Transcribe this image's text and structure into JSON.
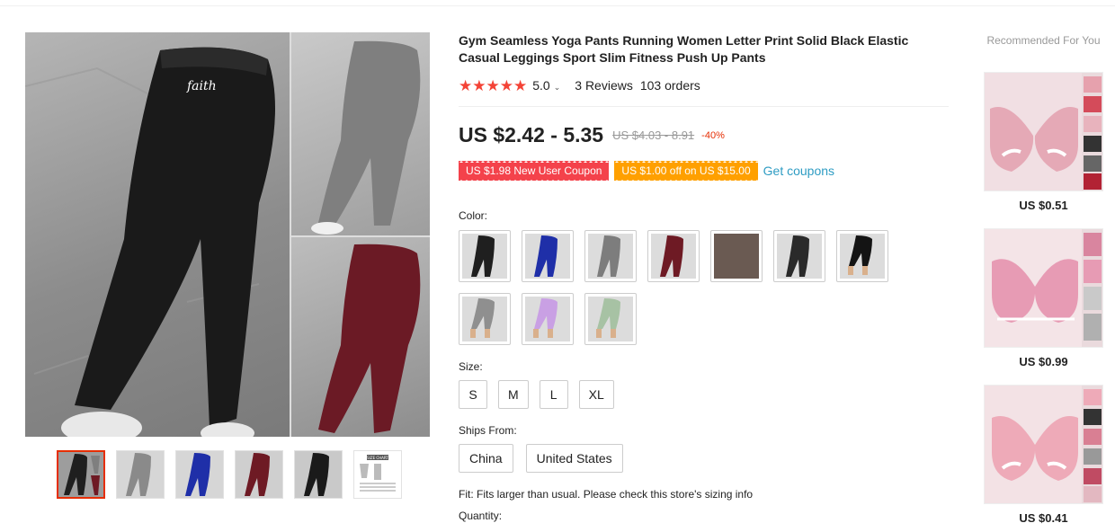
{
  "product": {
    "title": "Gym Seamless Yoga Pants Running Women Letter Print Solid Black Elastic Casual Leggings Sport Slim Fitness Push Up Pants",
    "rating": "5.0",
    "reviews": "3 Reviews",
    "orders": "103 orders",
    "price": "US $2.42 - 5.35",
    "original_price": "US $4.03 - 8.91",
    "discount": "-40%",
    "gallery_text": "faith"
  },
  "coupons": {
    "new_user": "US $1.98 New User Coupon",
    "store": "US $1.00 off on US $15.00",
    "get_link": "Get coupons"
  },
  "options": {
    "color_label": "Color:",
    "colors": [
      {
        "name": "black",
        "hex": "#1f1f1f"
      },
      {
        "name": "royal blue",
        "hex": "#1f2fa8"
      },
      {
        "name": "gray",
        "hex": "#7d7d7d"
      },
      {
        "name": "wine red",
        "hex": "#6e1a24"
      },
      {
        "name": "printed",
        "hex": "#6a5a52"
      },
      {
        "name": "black mesh",
        "hex": "#2a2a2a"
      },
      {
        "name": "black capri",
        "hex": "#141414"
      },
      {
        "name": "gray capri",
        "hex": "#8f8f8f"
      },
      {
        "name": "lilac capri",
        "hex": "#c9a0e4"
      },
      {
        "name": "mint capri",
        "hex": "#a7c2a4"
      }
    ],
    "size_label": "Size:",
    "sizes": [
      "S",
      "M",
      "L",
      "XL"
    ],
    "ships_label": "Ships From:",
    "ships": [
      "China",
      "United States"
    ],
    "fit_note": "Fit: Fits larger than usual. Please check this store's sizing info",
    "quantity_label": "Quantity:"
  },
  "thumbnails": [
    {
      "name": "collage",
      "hex": "#1f1f1f"
    },
    {
      "name": "gray",
      "hex": "#8a8a8a"
    },
    {
      "name": "blue",
      "hex": "#1f2fa8"
    },
    {
      "name": "wine",
      "hex": "#6e1a24"
    },
    {
      "name": "black",
      "hex": "#1a1a1a"
    },
    {
      "name": "size-chart",
      "hex": "#ffffff"
    }
  ],
  "size_chart_text": "SIZE CHART",
  "recommended": {
    "title": "Recommended For You",
    "items": [
      {
        "price": "US $0.51",
        "hex": "#e5a9b6"
      },
      {
        "price": "US $0.99",
        "hex": "#e79bb4"
      },
      {
        "price": "US $0.41",
        "hex": "#eeaab8"
      }
    ]
  },
  "colors": {
    "accent_red": "#f4424b",
    "coupon_orange": "#ffa000",
    "link_blue": "#2e9cc3",
    "star_red": "#f44336"
  }
}
